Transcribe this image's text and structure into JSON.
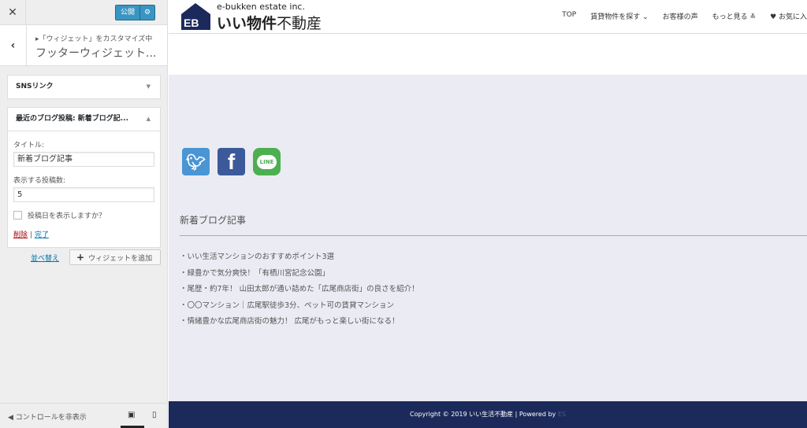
{
  "sidebar": {
    "close_icon": "close-icon",
    "publish_label": "公開",
    "breadcrumb": "▸「ウィジェット」をカスタマイズ中",
    "title": "フッターウィジェット...",
    "sections": [
      {
        "title": "SNSリンク"
      },
      {
        "title": "最近のブログ投稿: 新着ブログ記...",
        "title_label": "タイトル:",
        "title_value": "新着ブログ記事",
        "count_label": "表示する投稿数:",
        "count_value": "5",
        "show_date_label": "投稿日を表示しますか？",
        "show_date_checked": false,
        "delete_label": "削除",
        "separator": "|",
        "done_label": "完了"
      }
    ],
    "reorder_label": "並べ替え",
    "add_widget_label": "ウィジェットを追加",
    "hide_controls_label": "コントロールを非表示"
  },
  "site": {
    "tagline": "e-bukken estate inc.",
    "name_bold": "いい物件",
    "name_rest": "不動産",
    "logo_letters": "EB",
    "nav": [
      "TOP",
      "賃貸物件を探す ⌄",
      "お客様の声",
      "もっと見る ≚",
      "♥ お気に入"
    ],
    "sns": [
      "twitter",
      "facebook",
      "LINE"
    ],
    "widget_title": "新着ブログ記事",
    "posts": [
      "・いい生活マンションのおすすめポイント3選",
      "・緑豊かで気分爽快！「有栖川宮記念公園」",
      "・尾歴・約7年！ 山田太郎が通い詰めた「広尾商店街」の良さを紹介！",
      "・〇〇マンション｜広尾駅徒歩3分、ペット可の賃貸マンション",
      "・情緒豊かな広尾商店街の魅力！ 広尾がもっと楽しい街になる！"
    ],
    "copyright": "Copyright © 2019 いい生活不動産 | Powered by ",
    "powered_by": "ES"
  }
}
